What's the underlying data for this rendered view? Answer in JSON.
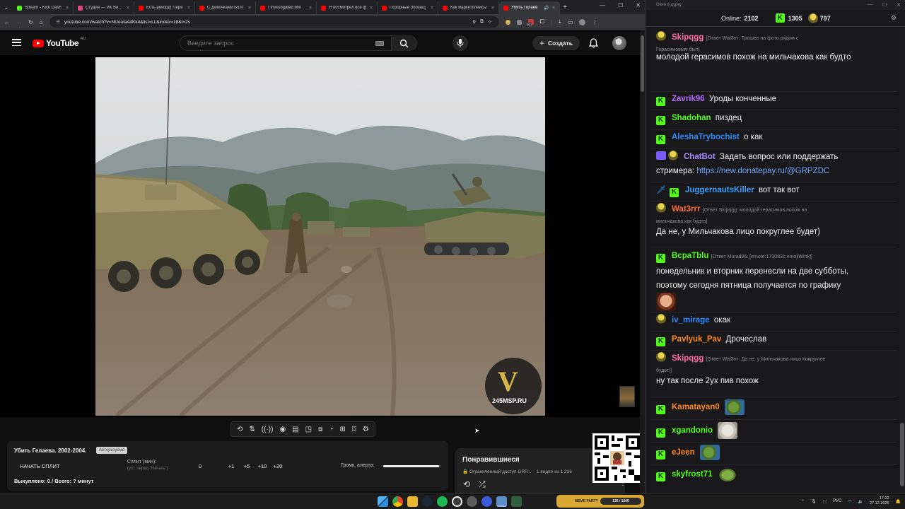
{
  "browser": {
    "tabs": [
      {
        "title": "Stream - Kick Dash",
        "color": "#53fc18",
        "active": false
      },
      {
        "title": "Студия — VK Видео",
        "color": "#e3467b",
        "active": false
      },
      {
        "title": "Есть рекорд! Пере",
        "color": "#ff0000",
        "active": false
      },
      {
        "title": "С Девочками Болт",
        "color": "#ff0000",
        "active": false
      },
      {
        "title": "I Investigated Min",
        "color": "#ff0000",
        "active": false
      },
      {
        "title": "Я посмотрел все ф",
        "color": "#ff0000",
        "active": false
      },
      {
        "title": "Позорные Зоозащ",
        "color": "#ff0000",
        "active": false
      },
      {
        "title": "Как маркетплейсы",
        "color": "#ff0000",
        "active": false
      },
      {
        "title": "Убить Гелаев",
        "color": "#ff0000",
        "active": true
      }
    ],
    "url": "youtube.com/watch?v=NUeota44Kk4&list=LL&index=18&t=2s",
    "ext_badge": "521"
  },
  "youtube": {
    "logo_text": "YouTube",
    "region": "RU",
    "search_placeholder": "Введите запрос",
    "create_label": "Создать"
  },
  "video": {
    "watermark": "245MSP.RU"
  },
  "split": {
    "title": "Убить Гелаева. 2002-2004.",
    "badge": "Авторизуемо",
    "start_label": "НАЧАТЬ СПЛИТ",
    "split_label": "Сплит (мин):",
    "split_sub": "(уст. перед \"Начать\")",
    "values": [
      "0",
      "+1",
      "+5",
      "+10",
      "+20"
    ],
    "volume_label": "Громк. алерта:",
    "volume_level": 0.98,
    "bought": "Выкуплено: 0 / Всего: ? минут"
  },
  "playlist": {
    "title": "Понравившиеся",
    "access": "Ограниченный доступ",
    "owner": "GRP...",
    "count": "1 видео из 1 226"
  },
  "chat": {
    "window_title": "Окно в дурку",
    "online_label": "Online:",
    "online": "2102",
    "kick_count": "1305",
    "coin_count": "797",
    "messages": [
      {
        "user": "Skipqgg",
        "color": "#ff6b9d",
        "badge": "emoji",
        "reply": "[Ответ Wat3rrr: Трошев на фото рядом с",
        "reply2": "Герасимовым был]",
        "text": "молодой герасимов похож на мильчакова как будто"
      },
      {
        "user": "Zavrik96",
        "color": "#b56bff",
        "badge": "kick",
        "text": "Уроды конченные"
      },
      {
        "user": "Shadohan",
        "color": "#53fc18",
        "badge": "kick",
        "text": "пиздец"
      },
      {
        "user": "AleshaTrybochist",
        "color": "#2e8bff",
        "badge": "kick",
        "text": "о как"
      },
      {
        "user": "ChatBot",
        "color": "#a98bff",
        "badge": "bot",
        "text": "Задать вопрос или поддержать",
        "text2": "стримера:",
        "link": "https://new.donatepay.ru/@GRPZDC"
      },
      {
        "user": "JuggernautsKiller",
        "color": "#3aa0ff",
        "badge": "sword",
        "text": "вот так вот"
      },
      {
        "user": "Wat3rrr",
        "color": "#ff6a3d",
        "badge": "emoji",
        "reply": "[Ответ Skipqgg: молодой герасимов похож на",
        "reply2": "мильчакова как будто]",
        "text": "Да не, у Мильчакова лицо покруглее будет)"
      },
      {
        "user": "BcpaTblu",
        "color": "#53fc18",
        "badge": "kick",
        "reply": "[Ответ Murad96: [emote:1730831:emojiWink]]",
        "text": "понедельник и вторник перенесли на две субботы,",
        "text2": "поэтому сегодня пятница получается по графику"
      },
      {
        "user": "iv_mirage",
        "color": "#2e8bff",
        "badge": "emoji",
        "text": "окак"
      },
      {
        "user": "Pavlyuk_Pav",
        "color": "#ff8a1f",
        "badge": "kick",
        "text": "Дрочеслав"
      },
      {
        "user": "Skipqgg",
        "color": "#ff6b9d",
        "badge": "emoji",
        "reply": "[Ответ Wat3rrr: Да не, у Мильчакова лицо покруглее",
        "reply2": "будет)]",
        "text": "ну так после 2ух пив похож"
      },
      {
        "user": "Kamatayan0",
        "color": "#ff8a1f",
        "badge": "kick",
        "text": ""
      },
      {
        "user": "xgandonio",
        "color": "#53fc18",
        "badge": "kick",
        "text": ""
      },
      {
        "user": "eJeen",
        "color": "#ff8a1f",
        "badge": "kick",
        "text": ""
      },
      {
        "user": "skyfrost71",
        "color": "#53fc18",
        "badge": "kick",
        "text": ""
      }
    ]
  },
  "taskbar": {
    "meme_label": "MEME PARTY",
    "meme_progress": "135 / 1500",
    "lang": "РУС",
    "time": "17:22",
    "date": "27.12.2025"
  }
}
